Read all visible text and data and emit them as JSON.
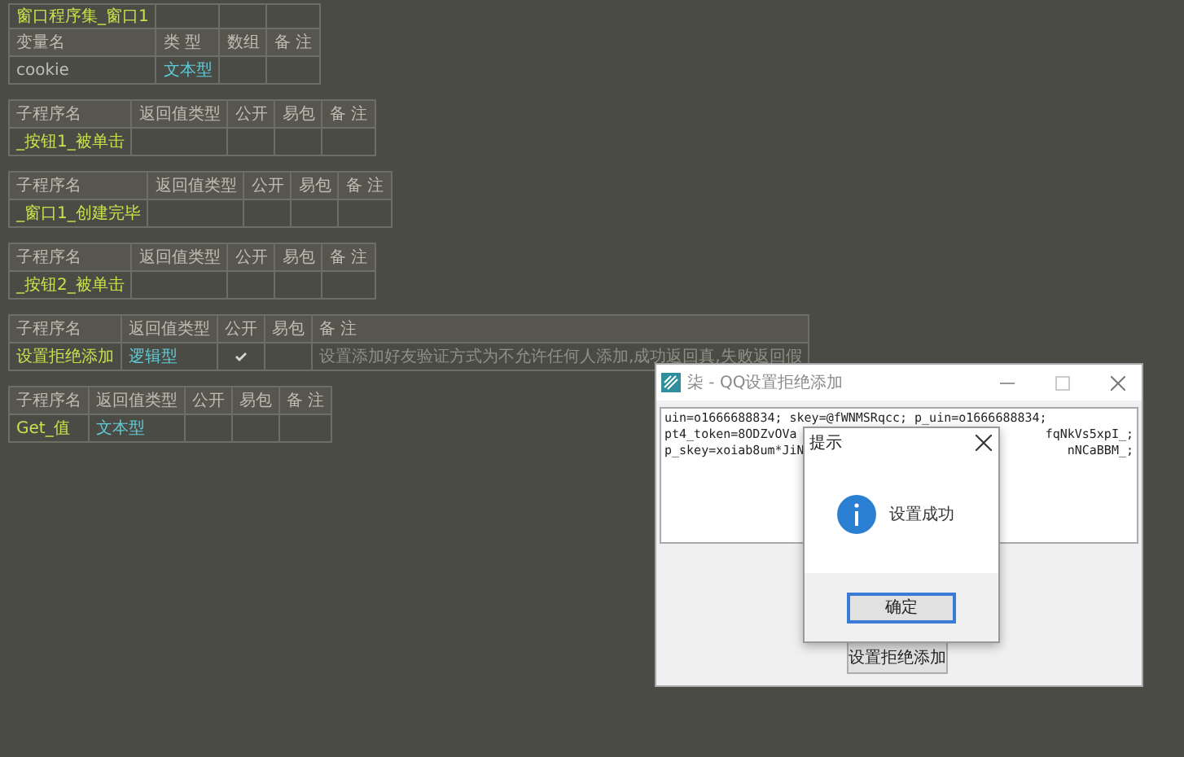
{
  "tables": [
    {
      "kind": "variables",
      "top_row": "窗口程序集_窗口1",
      "columns": [
        "变量名",
        "类 型",
        "数组",
        "备 注"
      ],
      "rows": [
        {
          "name": "cookie",
          "type": "文本型"
        }
      ]
    },
    {
      "kind": "subroutine",
      "columns": [
        "子程序名",
        "返回值类型",
        "公开",
        "易包",
        "备 注"
      ],
      "rows": [
        {
          "name": "_按钮1_被单击",
          "public": false
        }
      ]
    },
    {
      "kind": "subroutine",
      "columns": [
        "子程序名",
        "返回值类型",
        "公开",
        "易包",
        "备 注"
      ],
      "rows": [
        {
          "name": "_窗口1_创建完毕",
          "public": false
        }
      ]
    },
    {
      "kind": "subroutine",
      "columns": [
        "子程序名",
        "返回值类型",
        "公开",
        "易包",
        "备 注"
      ],
      "rows": [
        {
          "name": "_按钮2_被单击",
          "public": false
        }
      ]
    },
    {
      "kind": "subroutine",
      "columns": [
        "子程序名",
        "返回值类型",
        "公开",
        "易包",
        "备 注"
      ],
      "rows": [
        {
          "name": "设置拒绝添加",
          "type": "逻辑型",
          "public": true,
          "remark": "设置添加好友验证方式为不允许任何人添加,成功返回真,失败返回假"
        }
      ]
    },
    {
      "kind": "subroutine",
      "columns": [
        "子程序名",
        "返回值类型",
        "公开",
        "易包",
        "备 注"
      ],
      "rows": [
        {
          "name": "Get_值",
          "type": "文本型",
          "public": false
        }
      ]
    }
  ],
  "app_window": {
    "title": "柒 - QQ设置拒绝添加",
    "output_lines": [
      {
        "left": "uin=o1666688834; skey=@fWNMSRqcc; p_uin=o1666688834;"
      },
      {
        "left": "pt4_token=8ODZvOVa",
        "right": "fqNkVs5xpI_;"
      },
      {
        "left": "p_skey=xoiab8um*JiN",
        "right": "nNCaBBM_;"
      }
    ],
    "button": "设置拒绝添加"
  },
  "message_box": {
    "title": "提示",
    "message": "设置成功",
    "ok_button": "确定"
  }
}
